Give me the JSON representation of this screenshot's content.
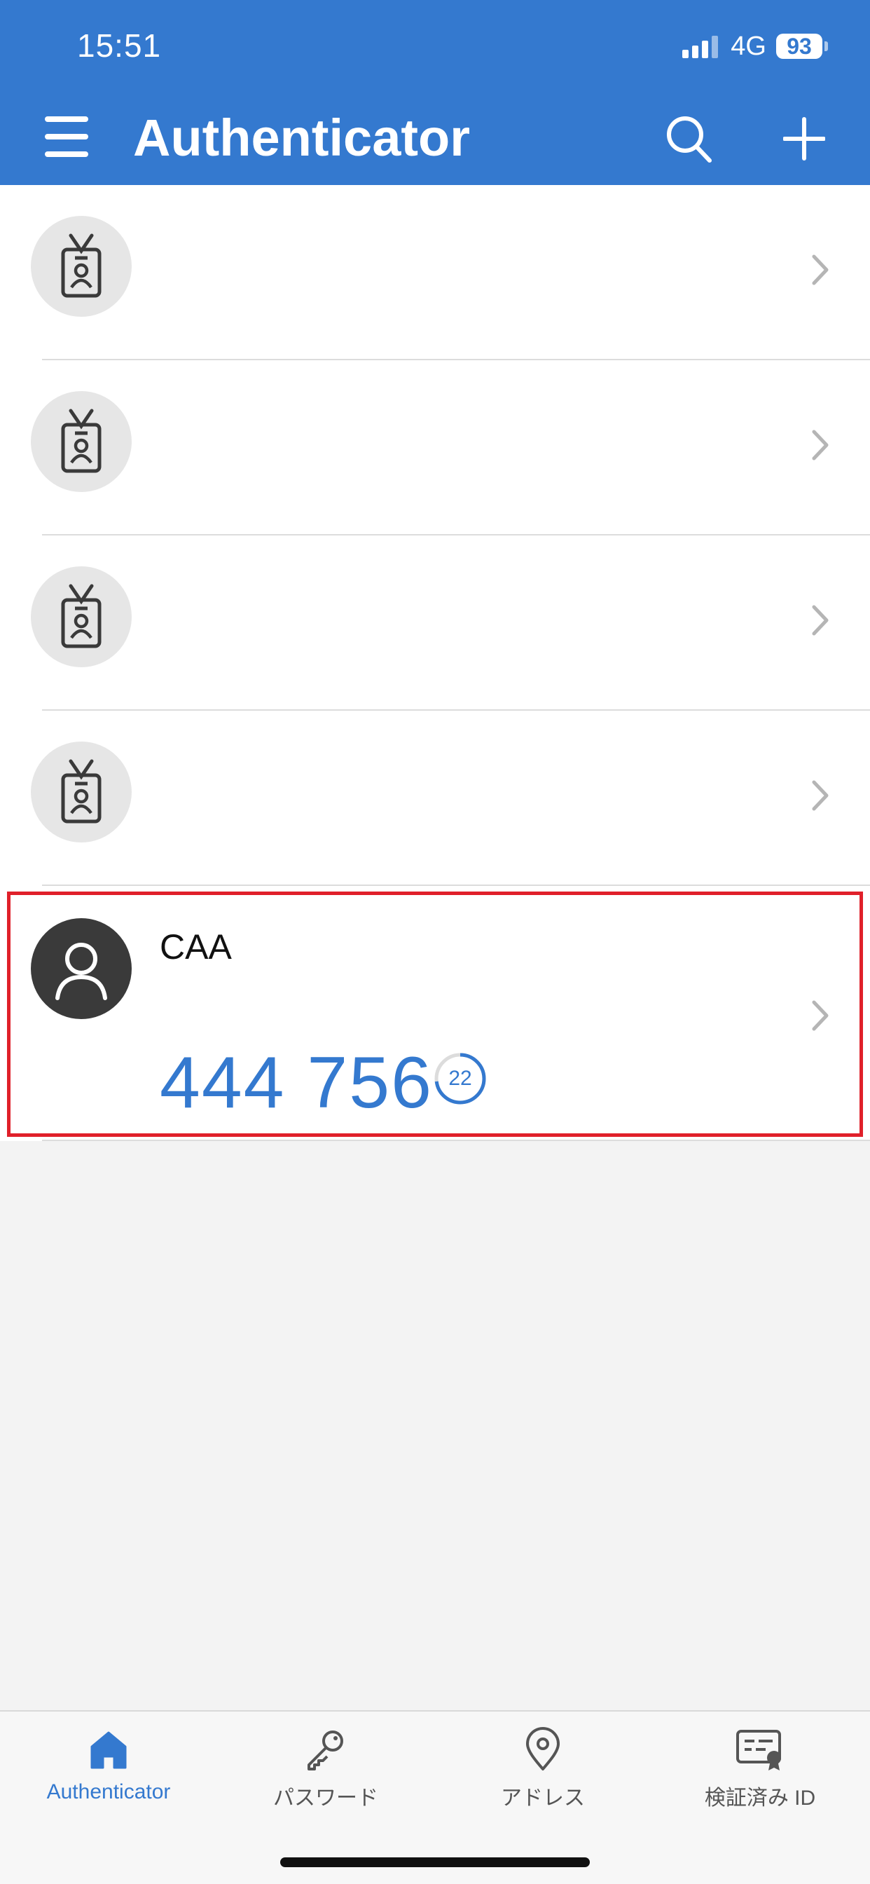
{
  "status_bar": {
    "time": "15:51",
    "network": "4G",
    "battery": "93"
  },
  "header": {
    "title": "Authenticator"
  },
  "accounts": [
    {
      "name": "",
      "icon": "badge-icon"
    },
    {
      "name": "",
      "icon": "badge-icon"
    },
    {
      "name": "",
      "icon": "badge-icon"
    },
    {
      "name": "",
      "icon": "badge-icon"
    },
    {
      "name": "CAA",
      "icon": "person-icon",
      "code": "444 756",
      "seconds_remaining": "22",
      "timer_fraction": 0.73
    }
  ],
  "tabs": [
    {
      "label": "Authenticator",
      "icon": "home-icon",
      "active": true
    },
    {
      "label": "パスワード",
      "icon": "key-icon",
      "active": false
    },
    {
      "label": "アドレス",
      "icon": "location-pin-icon",
      "active": false
    },
    {
      "label": "検証済み ID",
      "icon": "verified-id-icon",
      "active": false
    }
  ],
  "colors": {
    "brand": "#3479cf",
    "highlight": "#e0202a"
  }
}
